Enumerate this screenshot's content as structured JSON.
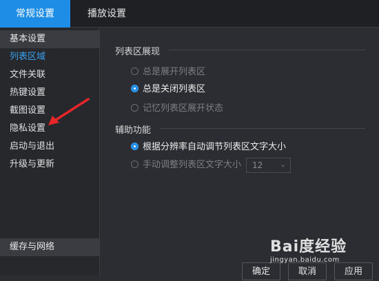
{
  "tabs": [
    {
      "label": "常规设置",
      "active": true
    },
    {
      "label": "播放设置",
      "active": false
    }
  ],
  "sidebar": {
    "header": "基本设置",
    "items": [
      {
        "label": "列表区域",
        "selected": true
      },
      {
        "label": "文件关联"
      },
      {
        "label": "热键设置"
      },
      {
        "label": "截图设置"
      },
      {
        "label": "隐私设置"
      },
      {
        "label": "启动与退出"
      },
      {
        "label": "升级与更新"
      }
    ],
    "bottom_header": "缓存与网络"
  },
  "list_display": {
    "title": "列表区展现",
    "options": [
      {
        "label": "总是展开列表区",
        "checked": false
      },
      {
        "label": "总是关闭列表区",
        "checked": true
      },
      {
        "label": "记忆列表区展开状态",
        "checked": false
      }
    ]
  },
  "assist": {
    "title": "辅助功能",
    "options": [
      {
        "label": "根据分辨率自动调节列表区文字大小",
        "checked": true
      },
      {
        "label": "手动调整列表区文字大小",
        "checked": false
      }
    ],
    "font_size_value": "12"
  },
  "buttons": {
    "ok": "确定",
    "cancel": "取消",
    "apply": "应用"
  },
  "watermark": {
    "logo": "Bai度经验",
    "url": "jingyan.baidu.com"
  },
  "colors": {
    "accent": "#1e8de6",
    "arrow": "#e8262a",
    "background": "#2b2d32"
  },
  "icons": {
    "dropdown": "chevron-down-icon",
    "annotation": "red-arrow-icon"
  }
}
